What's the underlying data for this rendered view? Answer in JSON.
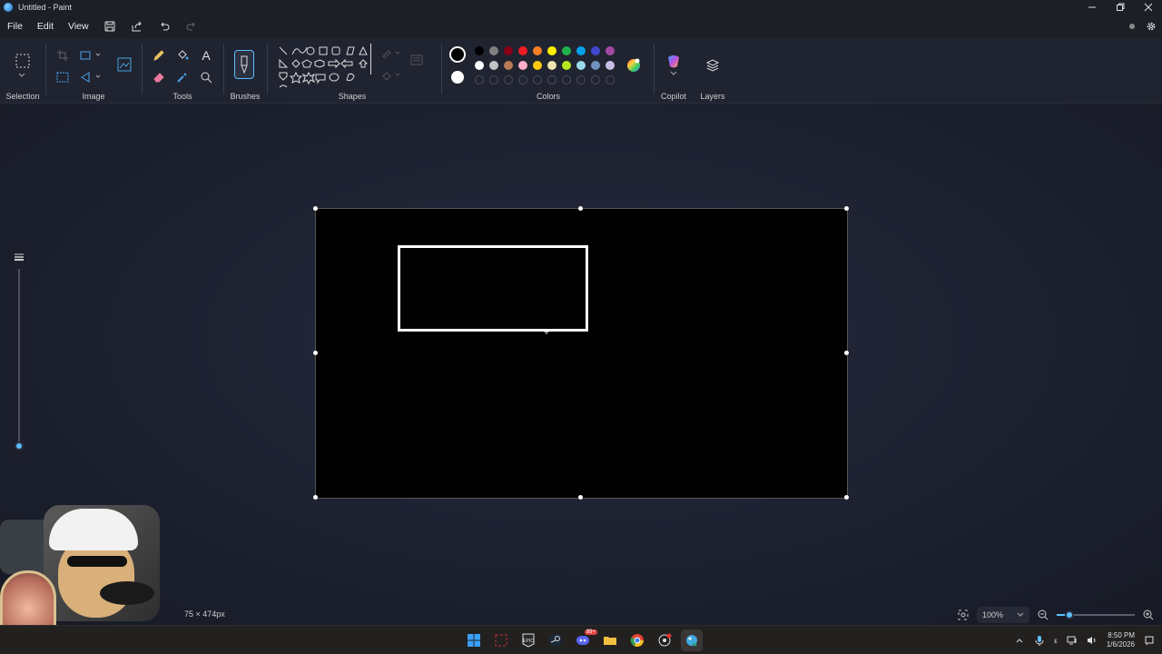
{
  "window": {
    "title": "Untitled - Paint",
    "controls": [
      "minimize",
      "restore",
      "close"
    ]
  },
  "menu": {
    "file": "File",
    "edit": "Edit",
    "view": "View",
    "quick_actions": [
      "save-icon",
      "share-icon",
      "undo-icon",
      "redo-icon"
    ]
  },
  "ribbon": {
    "groups": {
      "selection": "Selection",
      "image": "Image",
      "tools": "Tools",
      "brushes": "Brushes",
      "shapes": "Shapes",
      "colors": "Colors",
      "copilot": "Copilot",
      "layers": "Layers"
    },
    "text_tool_glyph": "A",
    "palette_row1": [
      "#000000",
      "#7f7f7f",
      "#880015",
      "#ed1c24",
      "#ff7f27",
      "#fff200",
      "#22b14c",
      "#00a2e8",
      "#3f48cc",
      "#a349a4"
    ],
    "palette_row2": [
      "#ffffff",
      "#c3c3c3",
      "#b97a57",
      "#ffaec9",
      "#ffc90e",
      "#efe4b0",
      "#b5e61d",
      "#99d9ea",
      "#7092be",
      "#c8bfe7"
    ],
    "primary_color": "#000000",
    "secondary_color": "#ffffff"
  },
  "status": {
    "canvas_size": "75 × 474px",
    "zoom": "100%",
    "zoom_level": 0.1
  },
  "taskbar": {
    "discord_badge": "99+",
    "clock_time": "8:50 PM",
    "clock_date": "1/6/2026",
    "tray_lang": "ε"
  }
}
